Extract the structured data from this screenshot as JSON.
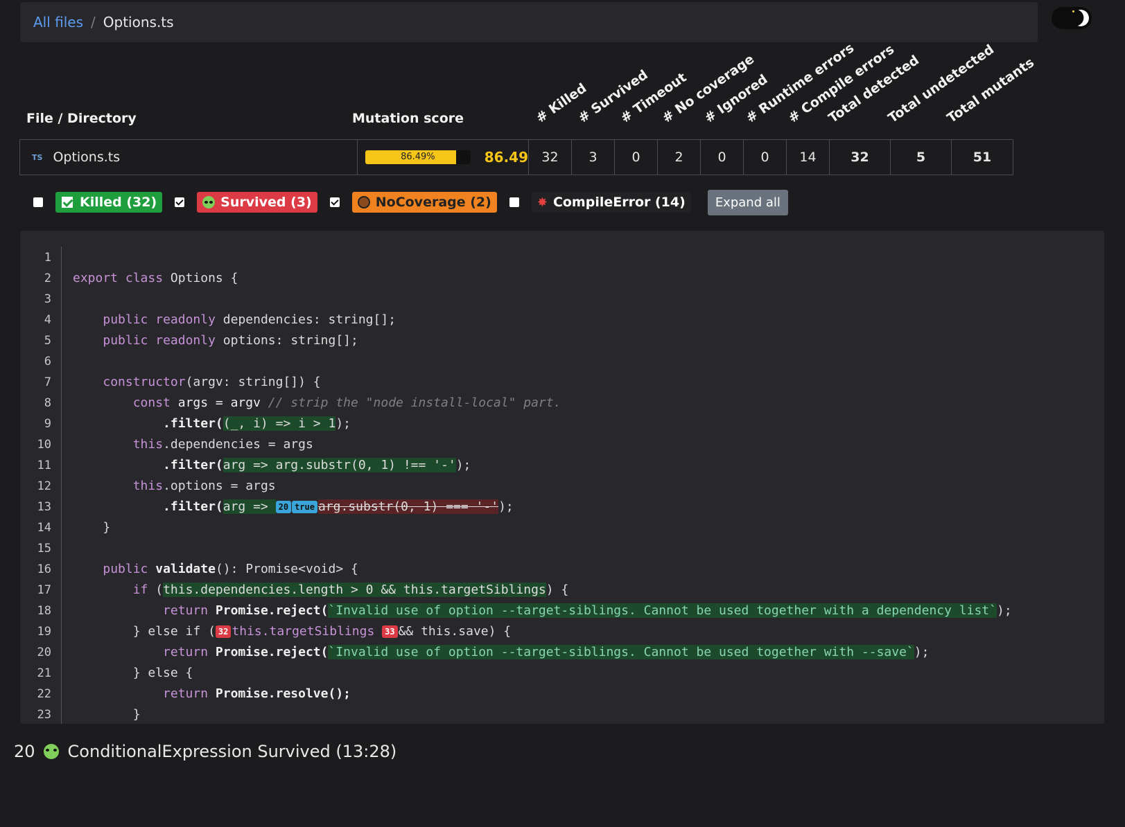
{
  "breadcrumb": {
    "root": "All files",
    "separator": "/",
    "current": "Options.ts"
  },
  "table": {
    "col_file": "File / Directory",
    "col_score": "Mutation score",
    "rotated_headers": [
      "# Killed",
      "# Survived",
      "# Timeout",
      "# No coverage",
      "# Ignored",
      "# Runtime errors",
      "# Compile errors",
      "Total detected",
      "Total undetected",
      "Total mutants"
    ],
    "row": {
      "icon": "TS",
      "file": "Options.ts",
      "progress_label": "86.49%",
      "progress_fraction": 0.8649,
      "score": "86.49",
      "values": [
        "32",
        "3",
        "0",
        "2",
        "0",
        "0",
        "14",
        "32",
        "5",
        "51"
      ]
    }
  },
  "filters": {
    "killed": "Killed (32)",
    "survived": "Survived (3)",
    "nocoverage": "NoCoverage (2)",
    "compile": "CompileError (14)",
    "expand": "Expand all"
  },
  "code": {
    "line_numbers": [
      "1",
      "2",
      "3",
      "4",
      "5",
      "6",
      "7",
      "8",
      "9",
      "10",
      "11",
      "12",
      "13",
      "14",
      "15",
      "16",
      "17",
      "18",
      "19",
      "20",
      "21",
      "22",
      "23"
    ],
    "l2": [
      "export",
      "class",
      "Options {"
    ],
    "l4": [
      "public",
      "readonly",
      "dependencies",
      ": string[];"
    ],
    "l5": [
      "public",
      "readonly",
      "options",
      ": string[];"
    ],
    "l7": [
      "constructor",
      "(argv",
      ": string[]) {"
    ],
    "l8": [
      "const",
      "args = argv",
      "// strip the \"node install-local\" part."
    ],
    "l9": [
      ".filter(",
      "(_, i) => i > 1",
      ");"
    ],
    "l10": [
      "this",
      ".dependencies = args"
    ],
    "l11": [
      ".filter(",
      "arg => arg.substr(0, 1) !== '-'",
      ");"
    ],
    "l12": [
      "this",
      ".options = args"
    ],
    "l13": [
      ".filter(",
      "arg => ",
      "20",
      "true",
      "arg.substr(0, 1) === '-'",
      ");"
    ],
    "l14": [
      "}"
    ],
    "l16": [
      "public",
      "validate",
      "(): Promise<void> {"
    ],
    "l17": [
      "if",
      "(",
      "this.dependencies.length > 0 && this.targetSiblings",
      ") {"
    ],
    "l18": [
      "return",
      "Promise.reject(",
      "`Invalid use of option --target-siblings. Cannot be used together with a dependency list`",
      ");"
    ],
    "l19": [
      "} else if (",
      "32",
      "this.targetSiblings ",
      "33",
      "&& this.save",
      ") {"
    ],
    "l20": [
      "return",
      "Promise.reject(",
      "`Invalid use of option --target-siblings. Cannot be used together with --save`",
      ");"
    ],
    "l21": [
      "} else {"
    ],
    "l22": [
      "return",
      "Promise.resolve();"
    ],
    "l23": [
      "}"
    ]
  },
  "status": {
    "id": "20",
    "text": "ConditionalExpression Survived (13:28)"
  }
}
